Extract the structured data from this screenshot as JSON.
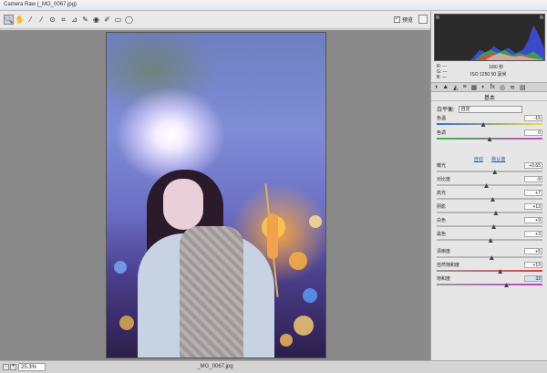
{
  "window": {
    "title": "Camera Raw (_MG_0067.jpg)"
  },
  "toolbar": {
    "tools": [
      {
        "name": "zoom-tool-icon",
        "glyph": "🔍"
      },
      {
        "name": "hand-tool-icon",
        "glyph": "✋"
      },
      {
        "name": "white-balance-tool-icon",
        "glyph": "⁄"
      },
      {
        "name": "color-sampler-tool-icon",
        "glyph": "⁄"
      },
      {
        "name": "targeted-adjust-tool-icon",
        "glyph": "⊙"
      },
      {
        "name": "crop-tool-icon",
        "glyph": "⌗"
      },
      {
        "name": "straighten-tool-icon",
        "glyph": "⊿"
      },
      {
        "name": "spot-removal-tool-icon",
        "glyph": "✎"
      },
      {
        "name": "red-eye-tool-icon",
        "glyph": "◉"
      },
      {
        "name": "adjustment-brush-icon",
        "glyph": "✐"
      },
      {
        "name": "graduated-filter-icon",
        "glyph": "▭"
      },
      {
        "name": "radial-filter-icon",
        "glyph": "◯"
      }
    ],
    "preview_label": "预览",
    "preview_checked": "✓"
  },
  "camera_info": {
    "rgb": [
      "R: ---",
      "G: ---",
      "B: ---"
    ],
    "shutter": "1/80 秒",
    "exposure": "ISO 1250   50 毫米"
  },
  "panel": {
    "tabs": [
      "◑",
      "▲",
      "◭",
      "≡",
      "▦",
      "◐",
      "fx",
      "◎",
      "≋",
      "▤"
    ],
    "section_title": "基本",
    "wb_label": "白平衡:",
    "wb_value": "自定",
    "links": {
      "auto": "自动",
      "default": "默认值"
    },
    "sliders": [
      {
        "label": "色温",
        "value": "-15",
        "pos": 0.44,
        "track": "temp"
      },
      {
        "label": "色调",
        "value": "0",
        "pos": 0.5,
        "track": "tint"
      },
      {
        "label": "曝光",
        "value": "+0.65",
        "pos": 0.55
      },
      {
        "label": "对比度",
        "value": "-9",
        "pos": 0.47
      },
      {
        "label": "高光",
        "value": "+7",
        "pos": 0.53
      },
      {
        "label": "阴影",
        "value": "+13",
        "pos": 0.56
      },
      {
        "label": "白色",
        "value": "+9",
        "pos": 0.54
      },
      {
        "label": "黑色",
        "value": "+3",
        "pos": 0.51
      },
      {
        "label": "清晰度",
        "value": "+5",
        "pos": 0.52
      },
      {
        "label": "自然饱和度",
        "value": "+19",
        "pos": 0.6,
        "track": "vib"
      },
      {
        "label": "饱和度",
        "value": "33",
        "pos": 0.66,
        "track": "sat",
        "highlight": true
      }
    ]
  },
  "status": {
    "zoom": "25.3%",
    "zoom_minus": "-",
    "zoom_plus": "+",
    "filename": "_MG_0067.jpg"
  },
  "colors": {
    "canvas": "#8a8a8a",
    "panel": "#e6e6e6",
    "accent": "#1f4fb0"
  }
}
